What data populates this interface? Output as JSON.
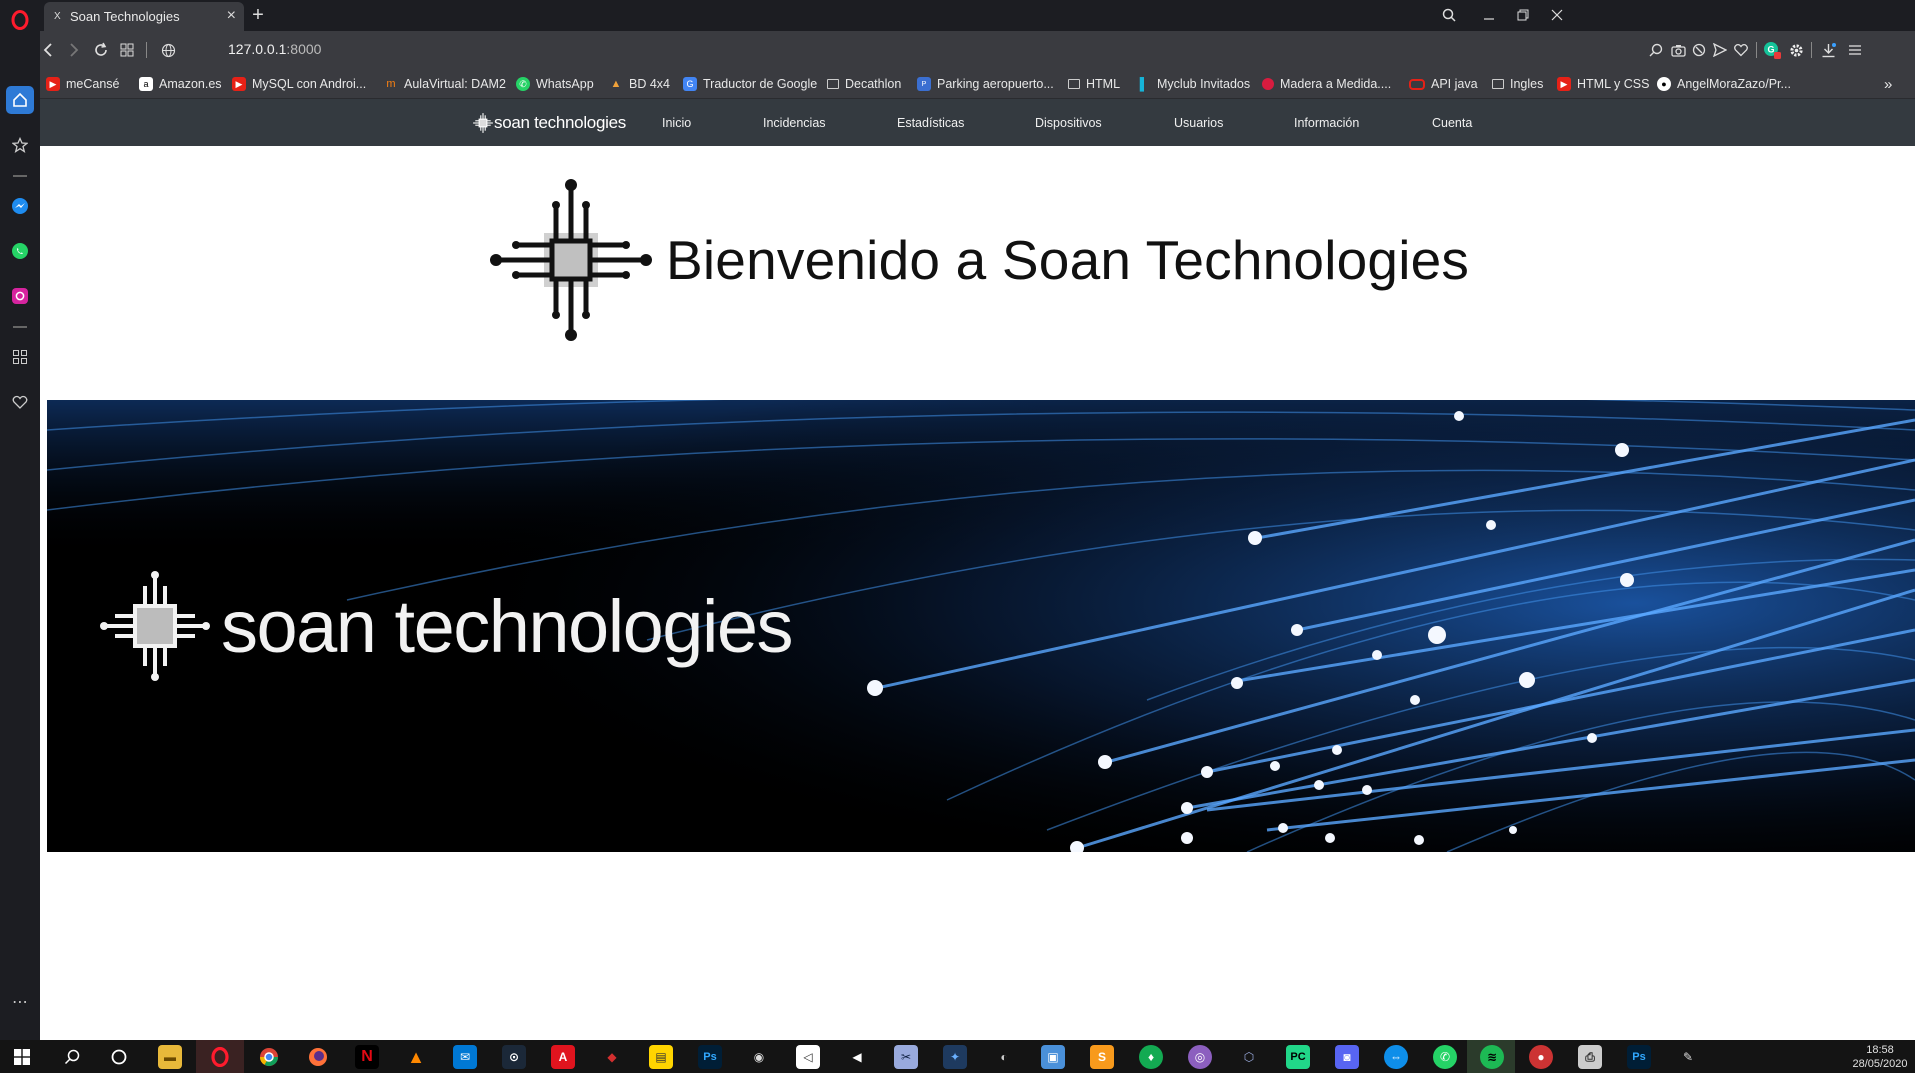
{
  "browser": {
    "tab_title": "Soan Technologies",
    "tab_favicon": "X",
    "new_tab": "+",
    "url_host": "127.0.0.1",
    "url_port": ":8000",
    "bookmarks": [
      {
        "label": "meCansé",
        "icon": "youtube-icon",
        "color": "#e62117"
      },
      {
        "label": "Amazon.es",
        "icon": "amazon-icon",
        "color": "#ffffff"
      },
      {
        "label": "MySQL con Androi...",
        "icon": "youtube-icon",
        "color": "#e62117"
      },
      {
        "label": "AulaVirtual: DAM2",
        "icon": "moodle-icon",
        "color": "#f98012"
      },
      {
        "label": "WhatsApp",
        "icon": "whatsapp-icon",
        "color": "#25d366"
      },
      {
        "label": "BD 4x4",
        "icon": "bd-icon",
        "color": "#f0a23a"
      },
      {
        "label": "Traductor de Google",
        "icon": "translate-icon",
        "color": "#4285f4"
      },
      {
        "label": "Decathlon",
        "icon": "folder-icon",
        "color": "#3a3b40"
      },
      {
        "label": "Parking aeropuerto...",
        "icon": "parking-icon",
        "color": "#3b6fd1"
      },
      {
        "label": "HTML",
        "icon": "folder-icon",
        "color": "#3a3b40"
      },
      {
        "label": "Myclub Invitados",
        "icon": "myclub-icon",
        "color": "#16b4d8"
      },
      {
        "label": "Madera a Medida....",
        "icon": "madera-icon",
        "color": "#d81c3f"
      },
      {
        "label": "API java",
        "icon": "oracle-icon",
        "color": "#e62117"
      },
      {
        "label": "Ingles",
        "icon": "folder-icon",
        "color": "#3a3b40"
      },
      {
        "label": "HTML y CSS",
        "icon": "youtube-icon",
        "color": "#e62117"
      },
      {
        "label": "AngelMoraZazo/Pr...",
        "icon": "github-icon",
        "color": "#ffffff"
      }
    ],
    "more": "»"
  },
  "site": {
    "brand": "soan technologies",
    "nav": [
      "Inicio",
      "Incidencias",
      "Estadísticas",
      "Dispositivos",
      "Usuarios",
      "Información",
      "Cuenta"
    ],
    "heading": "Bienvenido a Soan Technologies",
    "banner_text": "soan technologies"
  },
  "taskbar": {
    "time": "18:58",
    "date": "28/05/2020"
  },
  "colors": {
    "navbar": "#343a40",
    "browser_chrome": "#3a3b40",
    "sidebar": "#1c1d22",
    "accent": "#2e7ad6"
  }
}
